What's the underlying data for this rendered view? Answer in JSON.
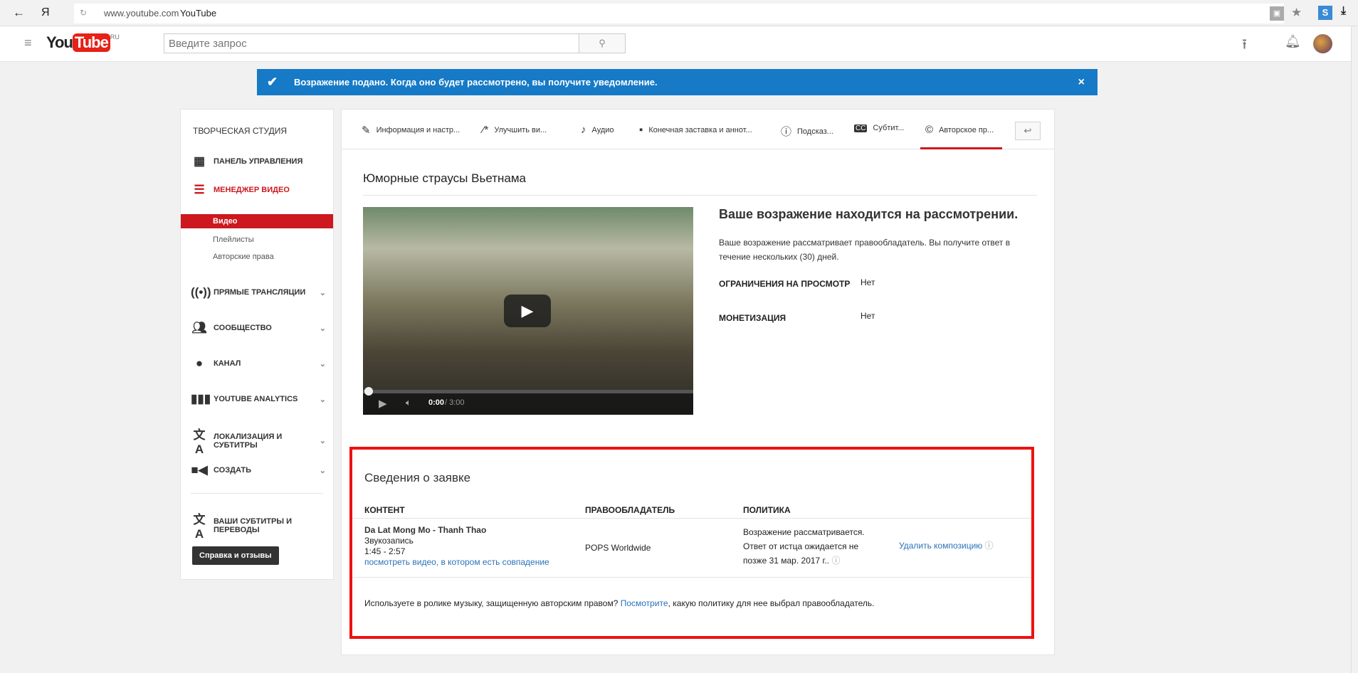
{
  "browser": {
    "url": "www.youtube.com",
    "title": "YouTube",
    "yandex": "Я"
  },
  "header": {
    "logo_you": "You",
    "logo_tube": "Tube",
    "logo_region": "RU",
    "search_placeholder": "Введите запрос"
  },
  "banner": {
    "text": "Возражение подано. Когда оно будет рассмотрено, вы получите уведомление.",
    "close": "×"
  },
  "sidebar": {
    "title": "ТВОРЧЕСКАЯ СТУДИЯ",
    "dashboard": "ПАНЕЛЬ УПРАВЛЕНИЯ",
    "video_manager": "МЕНЕДЖЕР ВИДЕО",
    "sub": [
      "Видео",
      "Плейлисты",
      "Авторские права"
    ],
    "sections": [
      "ПРЯМЫЕ ТРАНСЛЯЦИИ",
      "СООБЩЕСТВО",
      "КАНАЛ",
      "YOUTUBE ANALYTICS",
      "ЛОКАЛИЗАЦИЯ И СУБТИТРЫ",
      "СОЗДАТЬ"
    ],
    "your_subs": "ВАШИ СУБТИТРЫ И ПЕРЕВОДЫ",
    "help_button": "Справка и отзывы"
  },
  "tabs": [
    "Информация и настр...",
    "Улучшить ви...",
    "Аудио",
    "Конечная заставка и аннот...",
    "Подсказ...",
    "Субтит...",
    "Авторское пр..."
  ],
  "active_tab": 6,
  "video": {
    "title": "Юморные страусы Вьетнама",
    "time_current": "0:00",
    "time_total": " / 3:00"
  },
  "dispute": {
    "heading": "Ваше возражение находится на рассмотрении.",
    "text": "Ваше возражение рассматривает правообладатель. Вы получите ответ в течение нескольких (30) дней.",
    "restrictions_label": "ОГРАНИЧЕНИЯ НА ПРОСМОТР",
    "restrictions_value": "Нет",
    "monetization_label": "МОНЕТИЗАЦИЯ",
    "monetization_value": "Нет"
  },
  "claim": {
    "heading": "Сведения о заявке",
    "columns": [
      "КОНТЕНТ",
      "ПРАВООБЛАДАТЕЛЬ",
      "ПОЛИТИКА"
    ],
    "row": {
      "content_title": "Da Lat Mong Mo - Thanh Thao",
      "content_type": "Звукозапись",
      "range": "1:45 - 2:57",
      "match_link": "посмотреть видео, в котором есть совпадение",
      "owner": "POPS Worldwide",
      "policy_line1": "Возражение рассматривается.",
      "policy_line2": "Ответ от истца ожидается не",
      "policy_line3": "позже 31 мар. 2017 г..",
      "action": "Удалить композицию"
    },
    "footer_before": "Используете в ролике музыку, защищенную авторским правом? ",
    "footer_link": "Посмотрите",
    "footer_after": ", какую политику для нее выбрал правообладатель."
  },
  "colors": {
    "banner": "#167ac6",
    "accent": "#cc181e",
    "link": "#2a72b8",
    "highlight_box": "#ee1111"
  }
}
